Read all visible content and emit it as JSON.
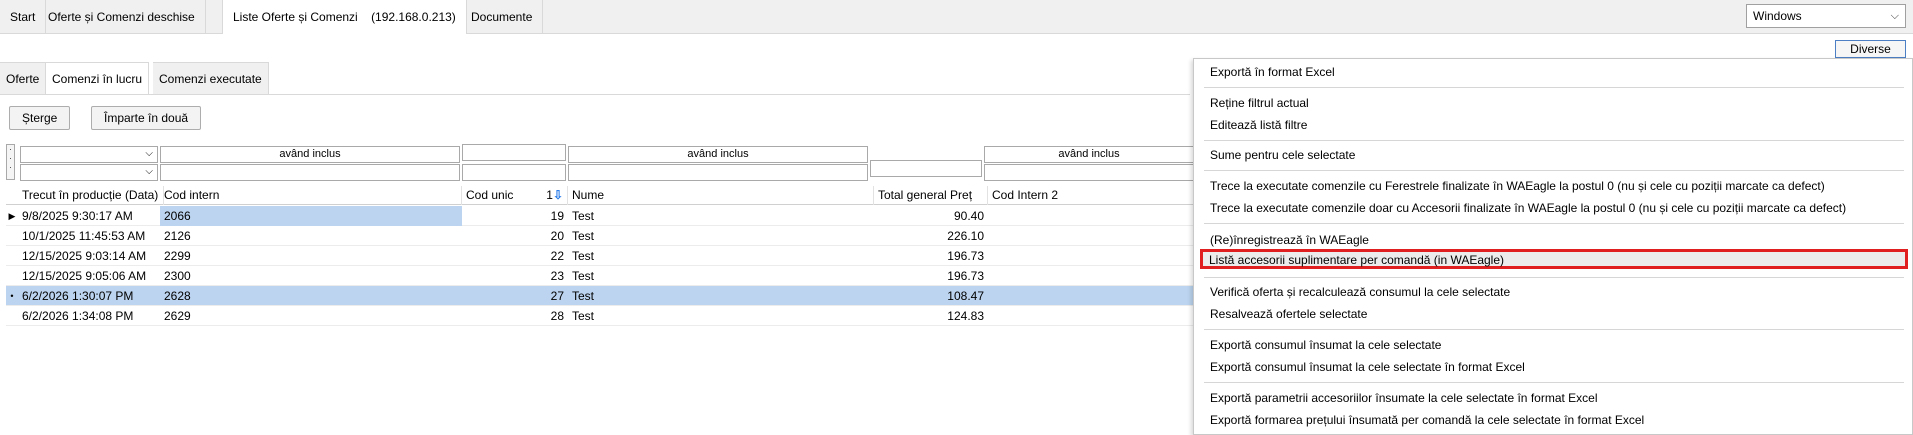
{
  "top_tabs": [
    "Start",
    "Oferte și Comenzi deschise",
    "Liste Oferte și Comenzi",
    "Documente"
  ],
  "active_tab_ip": "(192.168.0.213)",
  "window_select": {
    "value": "Windows"
  },
  "diverse_label": "Diverse",
  "sub_tabs": [
    "Oferte",
    "Comenzi în lucru",
    "Comenzi executate"
  ],
  "buttons": {
    "delete": "Șterge",
    "split": "Împarte în două"
  },
  "filters": {
    "including": "având inclus"
  },
  "columns": [
    "Trecut în producție (Data)",
    "Cod intern",
    "Cod unic",
    "Nume",
    "Total general Preț",
    "Cod Intern 2"
  ],
  "sort_index": "1",
  "rows": [
    {
      "date": "9/8/2025 9:30:17 AM",
      "intern": "2066",
      "unic": "19",
      "nume": "Test",
      "total": "90.40",
      "marker": "▶"
    },
    {
      "date": "10/1/2025 11:45:53 AM",
      "intern": "2126",
      "unic": "20",
      "nume": "Test",
      "total": "226.10",
      "marker": ""
    },
    {
      "date": "12/15/2025 9:03:14 AM",
      "intern": "2299",
      "unic": "22",
      "nume": "Test",
      "total": "196.73",
      "marker": ""
    },
    {
      "date": "12/15/2025 9:05:06 AM",
      "intern": "2300",
      "unic": "23",
      "nume": "Test",
      "total": "196.73",
      "marker": ""
    },
    {
      "date": "6/2/2026 1:30:07 PM",
      "intern": "2628",
      "unic": "27",
      "nume": "Test",
      "total": "108.47",
      "marker": "•"
    },
    {
      "date": "6/2/2026 1:34:08 PM",
      "intern": "2629",
      "unic": "28",
      "nume": "Test",
      "total": "124.83",
      "marker": ""
    }
  ],
  "menu": [
    "Exportă în format Excel",
    "Reține filtrul actual",
    "Editează listă filtre",
    "Sume pentru cele selectate",
    "Trece la executate comenzile cu Ferestrele finalizate în WAEagle la postul 0 (nu și cele cu poziții marcate ca defect)",
    "Trece la executate comenzile doar cu Accesorii finalizate în WAEagle la postul 0 (nu și cele cu poziții marcate ca defect)",
    "(Re)înregistrează în WAEagle",
    "Listă accesorii suplimentare per comandă (in WAEagle)",
    "Verifică oferta și recalculează consumul la cele selectate",
    "Resalvează ofertele selectate",
    "Exportă consumul însumat la cele selectate",
    "Exportă consumul însumat la cele selectate în format Excel",
    "Exportă parametrii accesoriilor însumate la cele selectate în format Excel",
    "Exportă formarea prețului însumată per comandă la cele selectate în format Excel"
  ],
  "colors": {
    "selection": "#bcd4ef",
    "highlight_border": "#e02020",
    "sort_arrow": "#2b7de9"
  }
}
